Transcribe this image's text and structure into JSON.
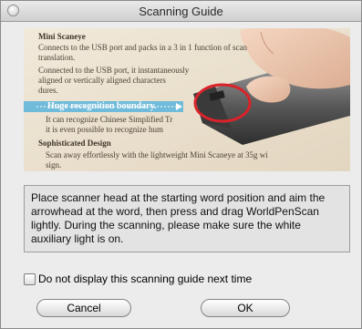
{
  "window": {
    "title": "Scanning Guide"
  },
  "illustration": {
    "lines": [
      "Mini Scaneye",
      "Connects to the USB port and packs in a 3 in 1 function of scan",
      "translation.",
      "Connected to the USB port, it instantaneously",
      "aligned or vertically aligned characters",
      "dures.",
      "Huge recognition boundary.",
      "It can recognize Chinese Simplified Tr",
      "it is even possible to recognize hum",
      "Sophisticated Design",
      "Scan away effortlessly with the lightweight Mini Scaneye at 35g wi",
      "sign."
    ],
    "highlight_color": "#5ab4dc"
  },
  "message": {
    "text": "Place scanner head at the starting word position and aim the arrowhead at the word, then press and drag WorldPenScan lightly. During the scanning, please make sure the white auxiliary light is on."
  },
  "options": {
    "dont_show_label": "Do not display this scanning guide next time",
    "dont_show_checked": false
  },
  "buttons": {
    "cancel": "Cancel",
    "ok": "OK"
  }
}
